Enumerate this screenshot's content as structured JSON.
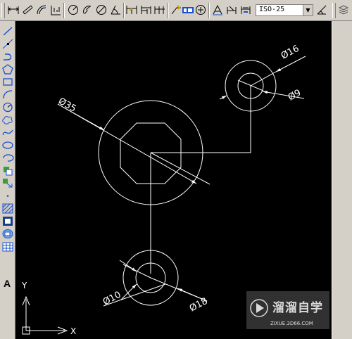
{
  "toolbar": {
    "dimstyle_value": "ISO-25",
    "tools": [
      "linear-dim",
      "aligned-dim",
      "arc-length-dim",
      "ordinate-dim",
      "radius-dim",
      "jogged-dim",
      "diameter-dim",
      "angular-dim",
      "quick-dim",
      "baseline-dim",
      "continue-dim",
      "quick-leader",
      "tolerance",
      "center-mark",
      "dim-edit",
      "dim-text-edit",
      "dim-update",
      "dimstyle-manager",
      "layers"
    ]
  },
  "sidebar": {
    "tools": [
      "line",
      "construction-line",
      "polyline",
      "polygon",
      "rectangle",
      "arc",
      "circle",
      "revision-cloud",
      "spline",
      "ellipse",
      "ellipse-arc",
      "insert-block",
      "make-block",
      "point",
      "hatch",
      "gradient",
      "region",
      "table",
      "multiline-text"
    ],
    "text_tool_label": "A"
  },
  "drawing": {
    "dims": {
      "d35": "Ø35",
      "d16": "Ø16",
      "d9": "Ø9",
      "d10": "Ø10",
      "d18": "Ø18"
    },
    "ucs": {
      "x_label": "X",
      "y_label": "Y"
    }
  },
  "watermark": {
    "title": "溜溜自学",
    "url": "ZIXUE.3D66.COM"
  }
}
